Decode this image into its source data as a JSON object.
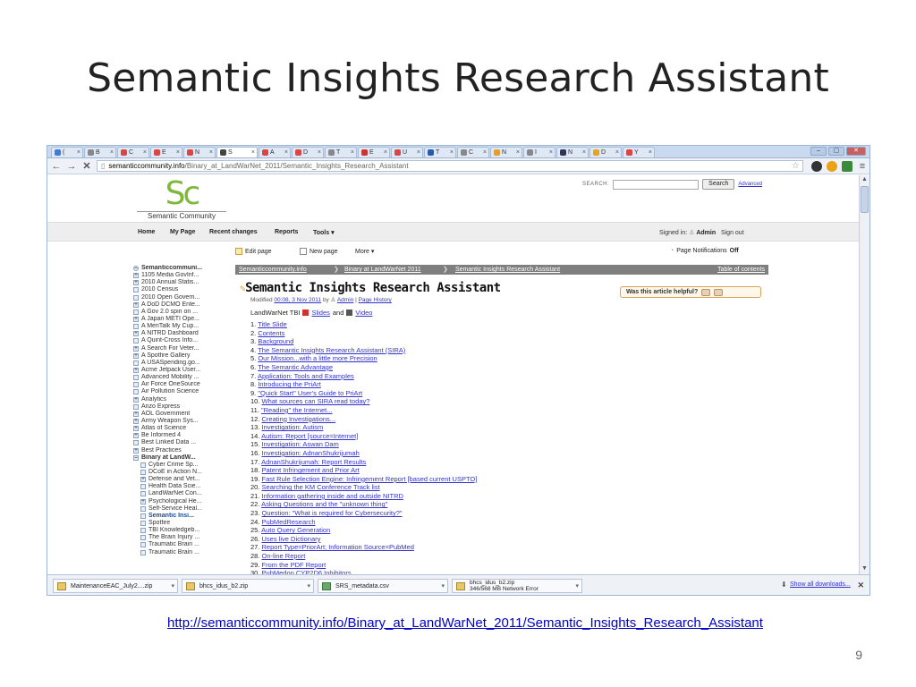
{
  "slide": {
    "title": "Semantic Insights Research Assistant",
    "link": "http://semanticcommunity.info/Binary_at_LandWarNet_2011/Semantic_Insights_Research_Assistant",
    "number": "9"
  },
  "browser": {
    "tabs": [
      "(",
      "B",
      "C",
      "E",
      "N",
      "S",
      "A",
      "D",
      "T",
      "E",
      "U",
      "T",
      "C",
      "N",
      "I",
      "N",
      "D",
      "Y"
    ],
    "active_tab_index": 5,
    "url_host": "semanticcommunity.info",
    "url_path": "/Binary_at_LandWarNet_2011/Semantic_Insights_Research_Assistant"
  },
  "site": {
    "logo_text": "Sc",
    "logo_tagline": "Semantic Community",
    "search_label": "SEARCH:",
    "search_button": "Search",
    "search_advanced": "Advanced",
    "menu": [
      "Home",
      "My Page",
      "Recent changes",
      "Reports",
      "Tools ▾"
    ],
    "signed_in_label": "Signed in:",
    "signed_in_user": "Admin",
    "sign_out": "Sign out"
  },
  "toolbar": {
    "edit_page": "Edit page",
    "new_page": "New page",
    "more": "More ▾",
    "notifications": "Page Notifications",
    "notifications_state": "Off"
  },
  "sidebar": {
    "root": "Semanticcommuni...",
    "items": [
      {
        "label": "1105 Media GovInf...",
        "type": "plus"
      },
      {
        "label": "2010 Annual Statis...",
        "type": "plus"
      },
      {
        "label": "2010 Census",
        "type": "leaf"
      },
      {
        "label": "2010 Open Govern...",
        "type": "leaf"
      },
      {
        "label": "A DoD DCMO Ente...",
        "type": "plus"
      },
      {
        "label": "A Gov 2.0 spin on ...",
        "type": "leaf"
      },
      {
        "label": "A Japan METI Ope...",
        "type": "plus"
      },
      {
        "label": "A MeriTalk My Cup...",
        "type": "leaf"
      },
      {
        "label": "A NITRD Dashboard",
        "type": "plus"
      },
      {
        "label": "A Quint-Cross Info...",
        "type": "leaf"
      },
      {
        "label": "A Search For Veter...",
        "type": "plus"
      },
      {
        "label": "A Spotfire Gallery",
        "type": "plus"
      },
      {
        "label": "A USASpending.go...",
        "type": "leaf"
      },
      {
        "label": "Acme Jetpack User...",
        "type": "plus"
      },
      {
        "label": "Advanced Mobility ...",
        "type": "leaf"
      },
      {
        "label": "Air Force OneSource",
        "type": "leaf"
      },
      {
        "label": "Air Pollution Science",
        "type": "leaf"
      },
      {
        "label": "Analytics",
        "type": "plus"
      },
      {
        "label": "Anzo Express",
        "type": "leaf"
      },
      {
        "label": "AOL Government",
        "type": "plus"
      },
      {
        "label": "Army Weapon Sys...",
        "type": "plus"
      },
      {
        "label": "Atlas of Science",
        "type": "plus"
      },
      {
        "label": "Be Informed 4",
        "type": "plus"
      },
      {
        "label": "Best Linked Data ...",
        "type": "leaf"
      },
      {
        "label": "Best Practices",
        "type": "plus"
      },
      {
        "label": "Binary at LandW...",
        "type": "minus"
      },
      {
        "label": "Cyber Crime Sp...",
        "type": "child"
      },
      {
        "label": "DCoE in Action N...",
        "type": "child"
      },
      {
        "label": "Defense and Vet...",
        "type": "childplus"
      },
      {
        "label": "Health Data Scie...",
        "type": "child"
      },
      {
        "label": "LandWarNet Con...",
        "type": "child"
      },
      {
        "label": "Psychological He...",
        "type": "childplus"
      },
      {
        "label": "Self-Service Heal...",
        "type": "child"
      },
      {
        "label": "Semantic Insi...",
        "type": "current"
      },
      {
        "label": "Spotfire",
        "type": "child"
      },
      {
        "label": "TBI Knowledgeb...",
        "type": "child"
      },
      {
        "label": "The Brain Injury ...",
        "type": "child"
      },
      {
        "label": "Traumatic Brain ...",
        "type": "child"
      },
      {
        "label": "Traumatic Brain ...",
        "type": "child"
      }
    ]
  },
  "breadcrumbs": {
    "items": [
      "Semanticcommunity.info",
      "Binary at LandWarNet 2011",
      "Semantic Insights Research Assistant"
    ],
    "toc": "Table of contents"
  },
  "article": {
    "title": "Semantic Insights Research Assistant",
    "modified_label": "Modified",
    "modified_date": "00:08, 3 Nov 2011",
    "by": "by",
    "author": "Admin",
    "history": "Page History",
    "helpful": "Was this article helpful?",
    "lw_prefix": "LandWarNet TBI",
    "slides": "Slides",
    "and": "and",
    "video": "Video",
    "toc": [
      "Title Slide",
      "Contents",
      "Background",
      "The Semantic Insights Research Assistant (SIRA)",
      "Our Mission...with a little more Precision",
      "The Semantic Advantage",
      "Application: Tools and Examples",
      "Introducing the PriArt",
      "\"Quick Start\" User's Guide to PriArt",
      "What sources can SIRA read today?",
      "\"Reading\" the Internet...",
      "Creating Investigations...",
      "Investigation: Autism",
      "Autism: Report [source=Internet]",
      "Investigation: Aswan Dam",
      "Investigation: AdnanShukrijumah",
      "AdnanShukrijumah: Report Results",
      "Patent Infringement and Prior Art",
      "Fast Rule Selection Engine: Infringement Report [based current USPTO]",
      "Searching the KM Conference Track list",
      "Information gathering inside and outside NITRD",
      "Asking Questions and the \"unknown thing\"",
      "Question: \"What is required for Cybersecurity?\"",
      "PubMedResearch",
      "Auto Query Generation",
      "Uses live Dictionary",
      "Report Type=PriorArt; Information Source=PubMed",
      "On-line Report",
      "From the PDF Report",
      "PubMedon CYP2D6 Inhibitors"
    ]
  },
  "downloads": {
    "items": [
      {
        "name": "MaintenanceEAC_July2....zip"
      },
      {
        "name": "bhcs_idus_b2.zip"
      },
      {
        "name": "SRS_metadata.csv"
      },
      {
        "name": "bhcs_idus_b2.zip",
        "status": "346/568 MB Network Error"
      }
    ],
    "show_all": "Show all downloads..."
  }
}
